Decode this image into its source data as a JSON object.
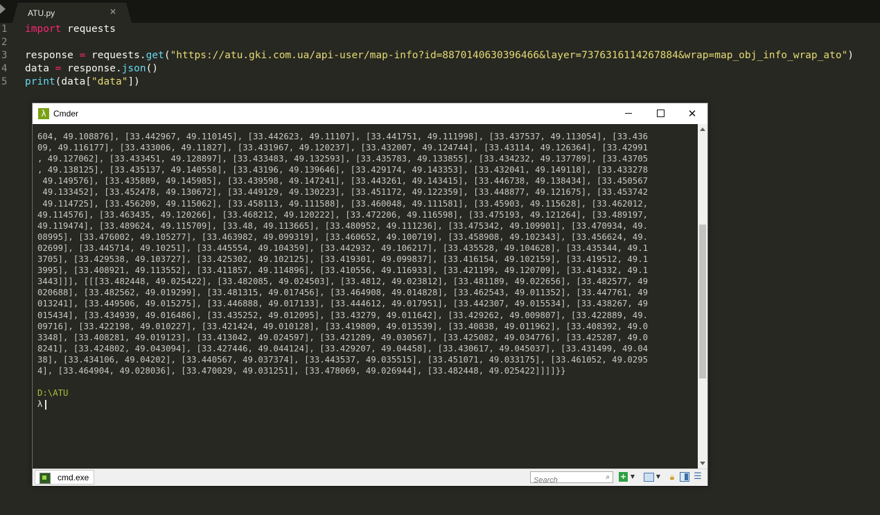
{
  "editor": {
    "tab_title": "ATU.py",
    "line_numbers": [
      "1",
      "2",
      "3",
      "4",
      "5"
    ],
    "code": {
      "line1_kw": "import",
      "line1_rest": " requests",
      "line3_a": "response ",
      "line3_eq": "=",
      "line3_b": " requests.",
      "line3_fn": "get",
      "line3_c": "(",
      "line3_str": "\"https://atu.gki.com.ua/api-user/map-info?id=8870140630396466&layer=7376316114267884&wrap=map_obj_info_wrap_ato\"",
      "line3_d": ")",
      "line4_a": "data ",
      "line4_eq": "=",
      "line4_b": " response.",
      "line4_fn": "json",
      "line4_c": "()",
      "line5_fn": "print",
      "line5_a": "(data[",
      "line5_str": "\"data\"",
      "line5_b": "])"
    }
  },
  "cmder": {
    "title": "Cmder",
    "output_lines": [
      "604, 49.108876], [33.442967, 49.110145], [33.442623, 49.11107], [33.441751, 49.111998], [33.437537, 49.113054], [33.436",
      "09, 49.116177], [33.433006, 49.11827], [33.431967, 49.120237], [33.432007, 49.124744], [33.43114, 49.126364], [33.42991",
      ", 49.127062], [33.433451, 49.128897], [33.433483, 49.132593], [33.435783, 49.133855], [33.434232, 49.137789], [33.43705",
      ", 49.138125], [33.435137, 49.140558], [33.43196, 49.139646], [33.429174, 49.143353], [33.432041, 49.149118], [33.433278",
      " 49.149576], [33.435889, 49.145985], [33.439598, 49.147241], [33.443261, 49.143415], [33.446738, 49.138434], [33.450567",
      " 49.133452], [33.452478, 49.130672], [33.449129, 49.130223], [33.451172, 49.122359], [33.448877, 49.121675], [33.453742",
      " 49.114725], [33.456209, 49.115062], [33.458113, 49.111588], [33.460048, 49.111581], [33.45903, 49.115628], [33.462012,",
      "49.114576], [33.463435, 49.120266], [33.468212, 49.120222], [33.472206, 49.116598], [33.475193, 49.121264], [33.489197,",
      "49.119474], [33.489624, 49.115709], [33.48, 49.113665], [33.480952, 49.111236], [33.475342, 49.109901], [33.470934, 49.",
      "08995], [33.476002, 49.105277], [33.463982, 49.099319], [33.460652, 49.100719], [33.458908, 49.102343], [33.456624, 49.",
      "02699], [33.445714, 49.10251], [33.445554, 49.104359], [33.442932, 49.106217], [33.435528, 49.104628], [33.435344, 49.1",
      "3705], [33.429538, 49.103727], [33.425302, 49.102125], [33.419301, 49.099837], [33.416154, 49.102159], [33.419512, 49.1",
      "3995], [33.408921, 49.113552], [33.411857, 49.114896], [33.410556, 49.116933], [33.421199, 49.120709], [33.414332, 49.1",
      "3443]]], [[[33.482448, 49.025422], [33.482085, 49.024503], [33.4812, 49.023812], [33.481189, 49.022656], [33.482577, 49",
      "020688], [33.482562, 49.019299], [33.481315, 49.017456], [33.464908, 49.014828], [33.462543, 49.011352], [33.447761, 49",
      "013241], [33.449506, 49.015275], [33.446888, 49.017133], [33.444612, 49.017951], [33.442307, 49.015534], [33.438267, 49",
      "015434], [33.434939, 49.016486], [33.435252, 49.012095], [33.43279, 49.011642], [33.429262, 49.009807], [33.422889, 49.",
      "09716], [33.422198, 49.010227], [33.421424, 49.010128], [33.419809, 49.013539], [33.40838, 49.011962], [33.408392, 49.0",
      "3348], [33.408281, 49.019123], [33.413042, 49.024597], [33.421289, 49.030567], [33.425082, 49.034776], [33.425287, 49.0",
      "8241], [33.424802, 49.043094], [33.427446, 49.044124], [33.429207, 49.04458], [33.430617, 49.045037], [33.431499, 49.04",
      "38], [33.434106, 49.04202], [33.440567, 49.037374], [33.443537, 49.035515], [33.451071, 49.033175], [33.461052, 49.0295",
      "4], [33.464904, 49.028036], [33.470029, 49.031251], [33.478069, 49.026944], [33.482448, 49.025422]]]]}}"
    ],
    "prompt_path": "D:\\ATU",
    "prompt_symbol": "λ",
    "console_tab_label": "cmd.exe",
    "search_placeholder": "Search"
  },
  "icons": {
    "app": "lambda-icon",
    "console_tab": "cmd-icon",
    "search": "magnifier-icon",
    "new_console": "plus-icon",
    "view": "window-icon",
    "lock": "lock-icon",
    "split": "split-view-icon",
    "menu": "hamburger-menu-icon"
  },
  "colors": {
    "editor_bg": "#272822",
    "keyword": "#f92672",
    "function": "#66d9ef",
    "string": "#e6db74",
    "prompt_path": "#a6c33b"
  }
}
